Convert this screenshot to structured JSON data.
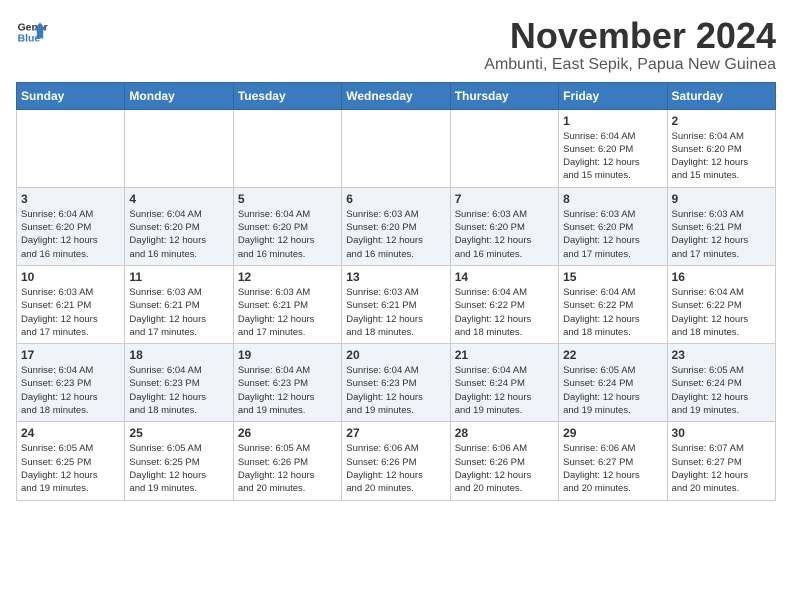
{
  "logo": {
    "line1": "General",
    "line2": "Blue"
  },
  "title": "November 2024",
  "location": "Ambunti, East Sepik, Papua New Guinea",
  "days_of_week": [
    "Sunday",
    "Monday",
    "Tuesday",
    "Wednesday",
    "Thursday",
    "Friday",
    "Saturday"
  ],
  "weeks": [
    [
      {
        "day": "",
        "info": ""
      },
      {
        "day": "",
        "info": ""
      },
      {
        "day": "",
        "info": ""
      },
      {
        "day": "",
        "info": ""
      },
      {
        "day": "",
        "info": ""
      },
      {
        "day": "1",
        "info": "Sunrise: 6:04 AM\nSunset: 6:20 PM\nDaylight: 12 hours\nand 15 minutes."
      },
      {
        "day": "2",
        "info": "Sunrise: 6:04 AM\nSunset: 6:20 PM\nDaylight: 12 hours\nand 15 minutes."
      }
    ],
    [
      {
        "day": "3",
        "info": "Sunrise: 6:04 AM\nSunset: 6:20 PM\nDaylight: 12 hours\nand 16 minutes."
      },
      {
        "day": "4",
        "info": "Sunrise: 6:04 AM\nSunset: 6:20 PM\nDaylight: 12 hours\nand 16 minutes."
      },
      {
        "day": "5",
        "info": "Sunrise: 6:04 AM\nSunset: 6:20 PM\nDaylight: 12 hours\nand 16 minutes."
      },
      {
        "day": "6",
        "info": "Sunrise: 6:03 AM\nSunset: 6:20 PM\nDaylight: 12 hours\nand 16 minutes."
      },
      {
        "day": "7",
        "info": "Sunrise: 6:03 AM\nSunset: 6:20 PM\nDaylight: 12 hours\nand 16 minutes."
      },
      {
        "day": "8",
        "info": "Sunrise: 6:03 AM\nSunset: 6:20 PM\nDaylight: 12 hours\nand 17 minutes."
      },
      {
        "day": "9",
        "info": "Sunrise: 6:03 AM\nSunset: 6:21 PM\nDaylight: 12 hours\nand 17 minutes."
      }
    ],
    [
      {
        "day": "10",
        "info": "Sunrise: 6:03 AM\nSunset: 6:21 PM\nDaylight: 12 hours\nand 17 minutes."
      },
      {
        "day": "11",
        "info": "Sunrise: 6:03 AM\nSunset: 6:21 PM\nDaylight: 12 hours\nand 17 minutes."
      },
      {
        "day": "12",
        "info": "Sunrise: 6:03 AM\nSunset: 6:21 PM\nDaylight: 12 hours\nand 17 minutes."
      },
      {
        "day": "13",
        "info": "Sunrise: 6:03 AM\nSunset: 6:21 PM\nDaylight: 12 hours\nand 18 minutes."
      },
      {
        "day": "14",
        "info": "Sunrise: 6:04 AM\nSunset: 6:22 PM\nDaylight: 12 hours\nand 18 minutes."
      },
      {
        "day": "15",
        "info": "Sunrise: 6:04 AM\nSunset: 6:22 PM\nDaylight: 12 hours\nand 18 minutes."
      },
      {
        "day": "16",
        "info": "Sunrise: 6:04 AM\nSunset: 6:22 PM\nDaylight: 12 hours\nand 18 minutes."
      }
    ],
    [
      {
        "day": "17",
        "info": "Sunrise: 6:04 AM\nSunset: 6:23 PM\nDaylight: 12 hours\nand 18 minutes."
      },
      {
        "day": "18",
        "info": "Sunrise: 6:04 AM\nSunset: 6:23 PM\nDaylight: 12 hours\nand 18 minutes."
      },
      {
        "day": "19",
        "info": "Sunrise: 6:04 AM\nSunset: 6:23 PM\nDaylight: 12 hours\nand 19 minutes."
      },
      {
        "day": "20",
        "info": "Sunrise: 6:04 AM\nSunset: 6:23 PM\nDaylight: 12 hours\nand 19 minutes."
      },
      {
        "day": "21",
        "info": "Sunrise: 6:04 AM\nSunset: 6:24 PM\nDaylight: 12 hours\nand 19 minutes."
      },
      {
        "day": "22",
        "info": "Sunrise: 6:05 AM\nSunset: 6:24 PM\nDaylight: 12 hours\nand 19 minutes."
      },
      {
        "day": "23",
        "info": "Sunrise: 6:05 AM\nSunset: 6:24 PM\nDaylight: 12 hours\nand 19 minutes."
      }
    ],
    [
      {
        "day": "24",
        "info": "Sunrise: 6:05 AM\nSunset: 6:25 PM\nDaylight: 12 hours\nand 19 minutes."
      },
      {
        "day": "25",
        "info": "Sunrise: 6:05 AM\nSunset: 6:25 PM\nDaylight: 12 hours\nand 19 minutes."
      },
      {
        "day": "26",
        "info": "Sunrise: 6:05 AM\nSunset: 6:26 PM\nDaylight: 12 hours\nand 20 minutes."
      },
      {
        "day": "27",
        "info": "Sunrise: 6:06 AM\nSunset: 6:26 PM\nDaylight: 12 hours\nand 20 minutes."
      },
      {
        "day": "28",
        "info": "Sunrise: 6:06 AM\nSunset: 6:26 PM\nDaylight: 12 hours\nand 20 minutes."
      },
      {
        "day": "29",
        "info": "Sunrise: 6:06 AM\nSunset: 6:27 PM\nDaylight: 12 hours\nand 20 minutes."
      },
      {
        "day": "30",
        "info": "Sunrise: 6:07 AM\nSunset: 6:27 PM\nDaylight: 12 hours\nand 20 minutes."
      }
    ]
  ]
}
